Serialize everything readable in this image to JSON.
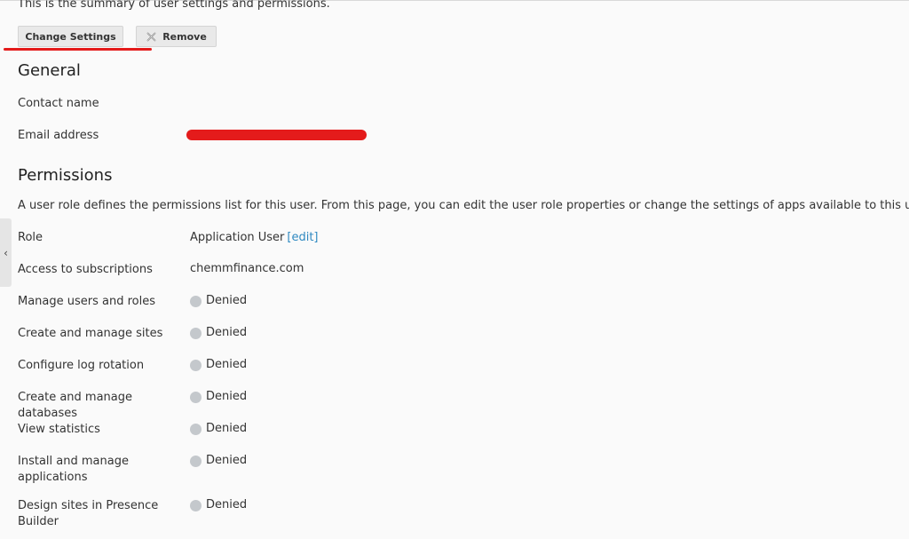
{
  "intro_text": "This is the summary of user settings and permissions.",
  "toolbar": {
    "change_settings_label": "Change Settings",
    "remove_label": "Remove"
  },
  "general": {
    "heading": "General",
    "contact_name_label": "Contact name",
    "contact_name_value": "",
    "email_label": "Email address"
  },
  "permissions": {
    "heading": "Permissions",
    "description": "A user role defines the permissions list for this user. From this page, you can edit the user role properties or change the settings of apps available to this user.",
    "role_label": "Role",
    "role_value": "Application User",
    "role_edit_link": "[edit]",
    "subscriptions_label": "Access to subscriptions",
    "subscriptions_value": "chemmfinance.com",
    "items": [
      {
        "label": "Manage users and roles",
        "status": "Denied"
      },
      {
        "label": "Create and manage sites",
        "status": "Denied"
      },
      {
        "label": "Configure log rotation",
        "status": "Denied"
      },
      {
        "label": "Create and manage databases",
        "status": "Denied"
      },
      {
        "label": "View statistics",
        "status": "Denied"
      },
      {
        "label": "Install and manage applications",
        "status": "Denied"
      },
      {
        "label": "Design sites in Presence Builder",
        "status": "Denied"
      }
    ]
  },
  "side_tab_icon": "chevron-left-icon",
  "colors": {
    "redaction": "#e41b1b",
    "link": "#2f89c1",
    "denied_dot": "#c4c8cc"
  }
}
